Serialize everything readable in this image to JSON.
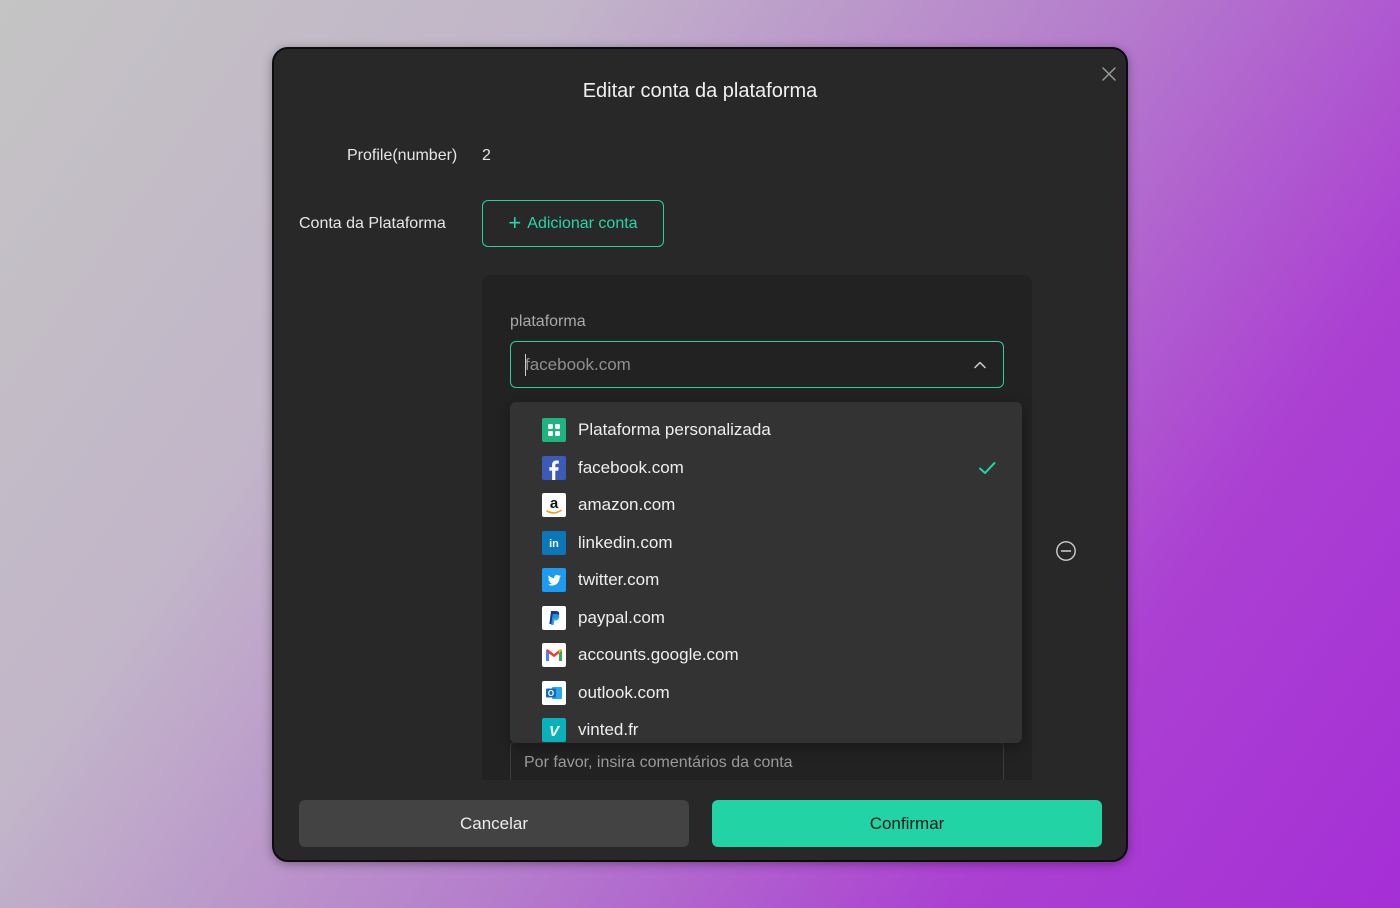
{
  "dialog": {
    "title": "Editar conta da plataforma",
    "profile_label": "Profile(number)",
    "profile_value": "2",
    "platform_account_label": "Conta da Plataforma",
    "add_account_label": "Adicionar conta"
  },
  "form": {
    "platform_label": "plataforma",
    "platform_value": "facebook.com",
    "comment_placeholder": "Por favor, insira comentários da conta"
  },
  "dropdown": {
    "selected": "facebook.com",
    "options": [
      {
        "label": "Plataforma personalizada",
        "icon": "custom-platform-icon"
      },
      {
        "label": "facebook.com",
        "icon": "facebook-icon"
      },
      {
        "label": "amazon.com",
        "icon": "amazon-icon"
      },
      {
        "label": "linkedin.com",
        "icon": "linkedin-icon"
      },
      {
        "label": "twitter.com",
        "icon": "twitter-icon"
      },
      {
        "label": "paypal.com",
        "icon": "paypal-icon"
      },
      {
        "label": "accounts.google.com",
        "icon": "gmail-icon"
      },
      {
        "label": "outlook.com",
        "icon": "outlook-icon"
      },
      {
        "label": "vinted.fr",
        "icon": "vinted-icon"
      }
    ]
  },
  "footer": {
    "cancel_label": "Cancelar",
    "confirm_label": "Confirmar"
  },
  "colors": {
    "accent": "#22d3a5",
    "dialog_bg": "#282828",
    "dropdown_bg": "#333333"
  }
}
